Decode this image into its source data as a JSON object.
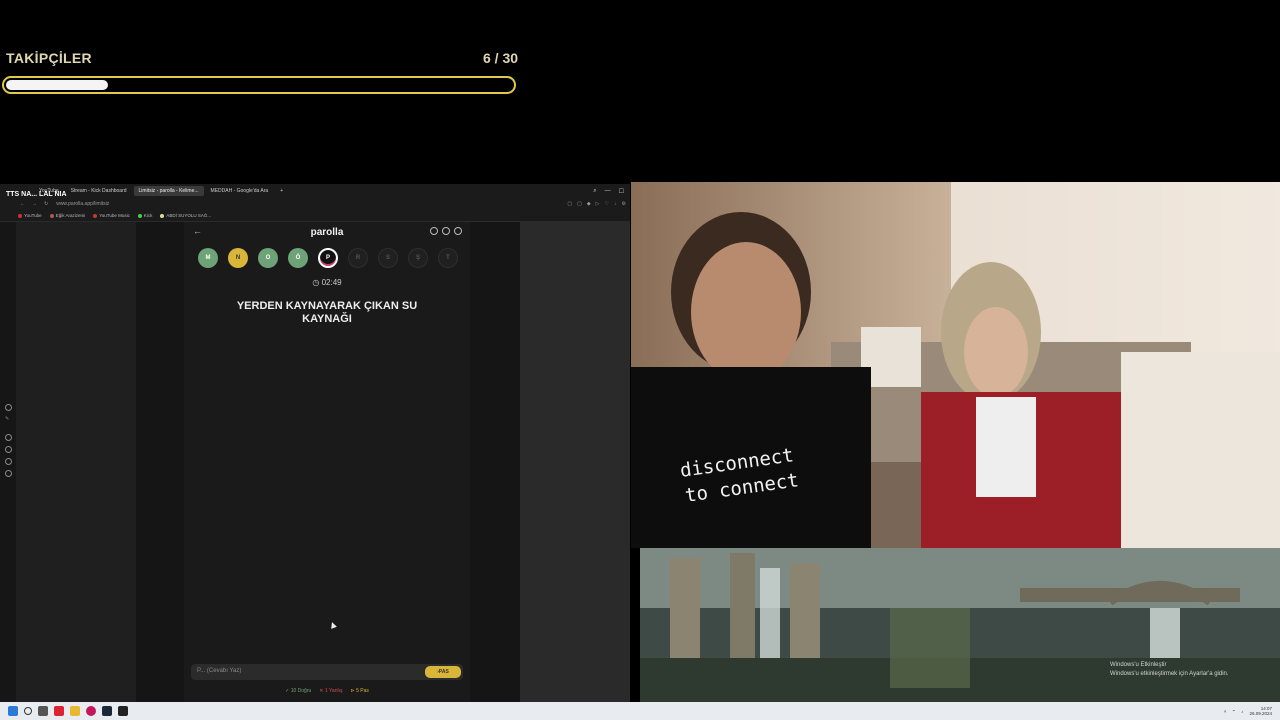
{
  "followers": {
    "title": "TAKİPÇİLER",
    "count": "6 / 30",
    "progress_fraction": 0.2
  },
  "stream_overlay": {
    "name_text": "TTS NA... LAL NIA"
  },
  "browser": {
    "tabs": [
      {
        "label": "YouTube"
      },
      {
        "label": "Stream - Kick Dashboard"
      },
      {
        "label": "Limitsiz - parolla - Kelime..."
      },
      {
        "label": "MEDDAH - Google'da Ara"
      }
    ],
    "active_tab_index": 2,
    "address": "www.parolla.app/limitsiz",
    "bookmarks": [
      {
        "label": "YouTube"
      },
      {
        "label": "Eğik Arazizemi"
      },
      {
        "label": "YouTube Music"
      },
      {
        "label": "Kick"
      },
      {
        "label": "ABDİ SUYOLU SAĞ..."
      }
    ]
  },
  "game": {
    "brand": "parolla",
    "letters": [
      {
        "char": "M",
        "state": "green"
      },
      {
        "char": "N",
        "state": "yellow"
      },
      {
        "char": "O",
        "state": "green"
      },
      {
        "char": "Ö",
        "state": "green"
      },
      {
        "char": "P",
        "state": "current"
      },
      {
        "char": "R",
        "state": "empty"
      },
      {
        "char": "S",
        "state": "empty"
      },
      {
        "char": "Ş",
        "state": "empty"
      },
      {
        "char": "T",
        "state": "empty"
      }
    ],
    "timer": "02:49",
    "question": "YERDEN KAYNAYARAK ÇIKAN SU KAYNAĞI",
    "answer_placeholder": "P... (Cevabı Yaz)",
    "pass_button": "PAS",
    "stats": {
      "correct": "10 Doğru",
      "wrong": "1 Yanlış",
      "passed": "5 Pas"
    }
  },
  "webcam": {
    "shirt_text_line1": "disconnect",
    "shirt_text_line2": "to connect"
  },
  "desktop": {
    "watermark_line1": "Windows'u Etkinleştir",
    "watermark_line2": "Windows'u etkinleştirmek için Ayarlar'a gidin."
  },
  "taskbar": {
    "time": "14:07",
    "date": "26.09.2024"
  },
  "colors": {
    "progress_border": "#e3c94a",
    "letter_green": "#6ea377",
    "letter_yellow": "#d9b63a",
    "pass_button": "#d9b63a"
  }
}
